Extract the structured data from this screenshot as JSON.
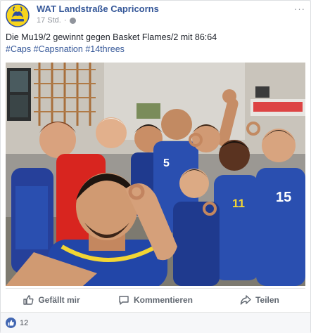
{
  "post": {
    "page_name": "WAT Landstraße Capricorns",
    "time": "17 Std.",
    "separator": "·",
    "audience_icon": "globe-icon",
    "more_label": "···",
    "text": "Die Mu19/2 gewinnt gegen Basket Flames/2 mit 86:64",
    "hashtags": [
      "#Caps",
      "#Capsnation",
      "#14threes"
    ],
    "photo_icon": "team-selfie-photo"
  },
  "actions": {
    "like_label": "Gefällt mir",
    "comment_label": "Kommentieren",
    "share_label": "Teilen"
  },
  "reactions": {
    "count": "12"
  },
  "colors": {
    "link_blue": "#365899",
    "like_blue": "#4267b2",
    "meta_gray": "#90949c",
    "jersey_blue": "#2a4fb0"
  }
}
